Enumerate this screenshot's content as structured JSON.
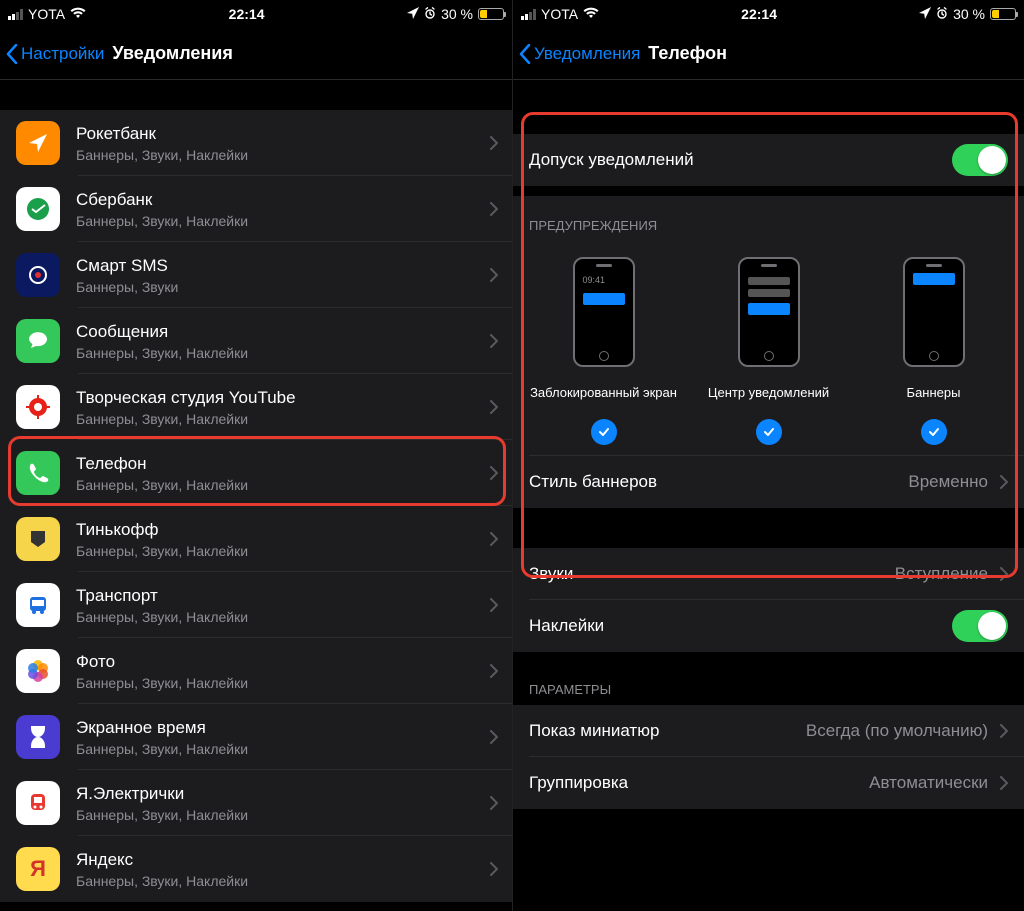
{
  "status": {
    "carrier": "YOTA",
    "time": "22:14",
    "battery_percent": "30 %"
  },
  "left": {
    "back_label": "Настройки",
    "title": "Уведомления",
    "apps": [
      {
        "name": "Рокетбанк",
        "sub": "Баннеры, Звуки, Наклейки"
      },
      {
        "name": "Сбербанк",
        "sub": "Баннеры, Звуки, Наклейки"
      },
      {
        "name": "Смарт SMS",
        "sub": "Баннеры, Звуки"
      },
      {
        "name": "Сообщения",
        "sub": "Баннеры, Звуки, Наклейки"
      },
      {
        "name": "Творческая студия YouTube",
        "sub": "Баннеры, Звуки, Наклейки"
      },
      {
        "name": "Телефон",
        "sub": "Баннеры, Звуки, Наклейки"
      },
      {
        "name": "Тинькофф",
        "sub": "Баннеры, Звуки, Наклейки"
      },
      {
        "name": "Транспорт",
        "sub": "Баннеры, Звуки, Наклейки"
      },
      {
        "name": "Фото",
        "sub": "Баннеры, Звуки, Наклейки"
      },
      {
        "name": "Экранное время",
        "sub": "Баннеры, Звуки, Наклейки"
      },
      {
        "name": "Я.Электрички",
        "sub": "Баннеры, Звуки, Наклейки"
      },
      {
        "name": "Яндекс",
        "sub": "Баннеры, Звуки, Наклейки"
      }
    ]
  },
  "right": {
    "back_label": "Уведомления",
    "title": "Телефон",
    "allow_label": "Допуск уведомлений",
    "alerts_header": "ПРЕДУПРЕЖДЕНИЯ",
    "alerts": [
      {
        "label": "Заблокированный экран",
        "mock_time": "09:41"
      },
      {
        "label": "Центр уведомлений",
        "mock_time": ""
      },
      {
        "label": "Баннеры",
        "mock_time": ""
      }
    ],
    "banner_style_label": "Стиль баннеров",
    "banner_style_value": "Временно",
    "sounds_label": "Звуки",
    "sounds_value": "Вступление",
    "badges_label": "Наклейки",
    "options_header": "ПАРАМЕТРЫ",
    "preview_label": "Показ миниатюр",
    "preview_value": "Всегда (по умолчанию)",
    "grouping_label": "Группировка",
    "grouping_value": "Автоматически"
  }
}
